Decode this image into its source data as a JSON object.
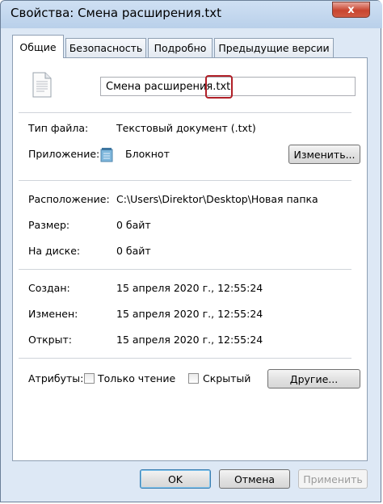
{
  "window": {
    "title": "Свойства: Смена расширения.txt",
    "close_glyph": "x"
  },
  "tabs": [
    {
      "label": "Общие",
      "active": true
    },
    {
      "label": "Безопасность",
      "active": false
    },
    {
      "label": "Подробно",
      "active": false
    },
    {
      "label": "Предыдущие версии",
      "active": false
    }
  ],
  "file": {
    "name": "Смена расширения.txt",
    "icon": "text-file-icon"
  },
  "fields": {
    "type_label": "Тип файла:",
    "type_value": "Текстовый документ (.txt)",
    "app_label": "Приложение:",
    "app_value": "Блокнот",
    "app_icon": "notepad-icon",
    "change_button": "Изменить...",
    "location_label": "Расположение:",
    "location_value": "C:\\Users\\Direktor\\Desktop\\Новая папка",
    "size_label": "Размер:",
    "size_value": "0 байт",
    "disk_label": "На диске:",
    "disk_value": "0 байт",
    "created_label": "Создан:",
    "created_value": "15 апреля 2020 г., 12:55:24",
    "modified_label": "Изменен:",
    "modified_value": "15 апреля 2020 г., 12:55:24",
    "opened_label": "Открыт:",
    "opened_value": "15 апреля 2020 г., 12:55:24",
    "attributes_label": "Атрибуты:",
    "readonly_label": "Только чтение",
    "readonly_checked": false,
    "hidden_label": "Скрытый",
    "hidden_checked": false,
    "other_button": "Другие..."
  },
  "footer": {
    "ok": "OK",
    "cancel": "Отмена",
    "apply": "Применить",
    "apply_enabled": false
  },
  "colors": {
    "highlight": "#b01f27",
    "window_frame": "#dde8f5",
    "close_button": "#c8452f"
  }
}
